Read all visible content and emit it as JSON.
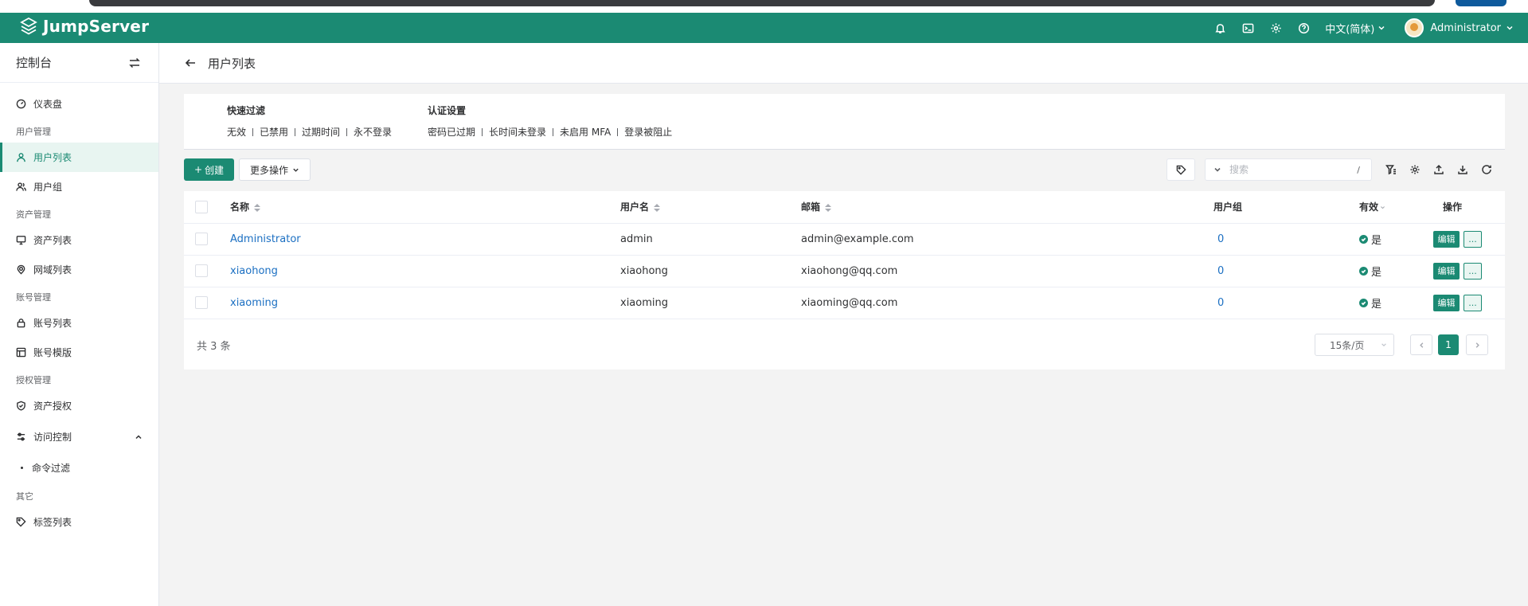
{
  "app": {
    "name": "JumpServer"
  },
  "topbar": {
    "language": "中文(简体)",
    "user": "Administrator"
  },
  "sidebar": {
    "title": "控制台",
    "dashboard": "仪表盘",
    "groups": {
      "users": "用户管理",
      "assets": "资产管理",
      "accounts": "账号管理",
      "perms": "授权管理",
      "others": "其它"
    },
    "items": {
      "user_list": "用户列表",
      "user_group": "用户组",
      "asset_list": "资产列表",
      "domain_list": "网域列表",
      "account_list": "账号列表",
      "account_template": "账号模版",
      "asset_perm": "资产授权",
      "access_control": "访问控制",
      "command_filter": "命令过滤",
      "label_list": "标签列表"
    }
  },
  "page": {
    "title": "用户列表"
  },
  "filters": {
    "quick": {
      "title": "快速过滤",
      "options": [
        "无效",
        "已禁用",
        "过期时间",
        "永不登录"
      ]
    },
    "auth": {
      "title": "认证设置",
      "options": [
        "密码已过期",
        "长时间未登录",
        "未启用 MFA",
        "登录被阻止"
      ]
    }
  },
  "toolbar": {
    "create": "创建",
    "more": "更多操作",
    "search_placeholder": "搜索",
    "search_shortcut": "/"
  },
  "table": {
    "headers": {
      "name": "名称",
      "username": "用户名",
      "email": "邮箱",
      "groups": "用户组",
      "valid": "有效",
      "actions": "操作"
    },
    "rows": [
      {
        "name": "Administrator",
        "username": "admin",
        "email": "admin@example.com",
        "groups": "0",
        "valid": "是"
      },
      {
        "name": "xiaohong",
        "username": "xiaohong",
        "email": "xiaohong@qq.com",
        "groups": "0",
        "valid": "是"
      },
      {
        "name": "xiaoming",
        "username": "xiaoming",
        "email": "xiaoming@qq.com",
        "groups": "0",
        "valid": "是"
      }
    ],
    "edit_label": "编辑",
    "more_label": "..."
  },
  "pagination": {
    "total": "共 3 条",
    "page_size": "15条/页",
    "current": "1"
  },
  "colors": {
    "brand": "#1b8a73",
    "link": "#1b6fc2"
  }
}
